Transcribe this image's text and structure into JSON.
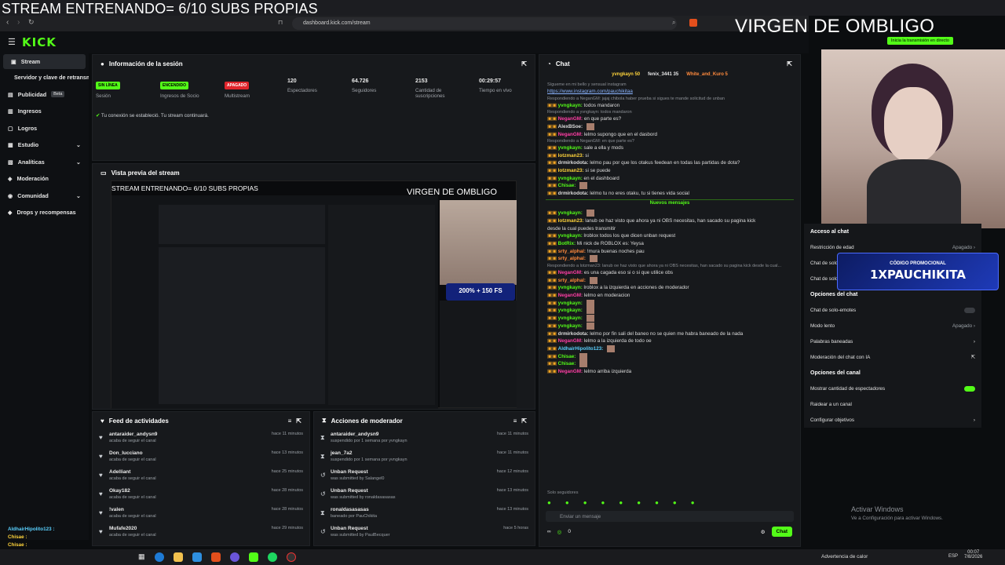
{
  "overlay": {
    "left_title": "STREAM ENTRENANDO= 6/10 SUBS PROPIAS",
    "right_title": "VIRGEN DE OMBLIGO"
  },
  "browser": {
    "url": "dashboard.kick.com/stream"
  },
  "brand": {
    "logo": "KICK",
    "accent": "#53fc18"
  },
  "header": {
    "start_stream": "Inicia la transmisión en directo"
  },
  "sidebar": {
    "items": [
      {
        "label": "Stream",
        "icon": "stream-icon"
      },
      {
        "label": "Servidor y clave de retransmisión",
        "icon": ""
      },
      {
        "label": "Publicidad",
        "icon": "ad-icon",
        "badge": "Beta"
      },
      {
        "label": "Ingresos",
        "icon": "money-icon"
      },
      {
        "label": "Logros",
        "icon": "trophy-icon"
      },
      {
        "label": "Estudio",
        "icon": "studio-icon"
      },
      {
        "label": "Analíticas",
        "icon": "analytics-icon"
      },
      {
        "label": "Moderación",
        "icon": "shield-icon"
      },
      {
        "label": "Comunidad",
        "icon": "community-icon"
      },
      {
        "label": "Drops y recompensas",
        "icon": "gift-icon"
      }
    ]
  },
  "session": {
    "title": "Información de la sesión",
    "stats": [
      {
        "badge": "SIN LÍNEA",
        "label": "Sesión"
      },
      {
        "badge": "ENCENDIDO",
        "label": "Ingresos de Socio"
      },
      {
        "badge": "APAGADO",
        "label": "Multistream"
      },
      {
        "value": "120",
        "label": "Espectadores"
      },
      {
        "value": "64.726",
        "label": "Seguidores"
      },
      {
        "value": "2153",
        "label": "Cantidad de suscripciones"
      },
      {
        "value": "00:29:57",
        "label": "Tiempo en vivo"
      }
    ],
    "status": "Tu conexión se estableció. Tu stream continuará."
  },
  "preview": {
    "title": "Vista previa del stream",
    "promo_line1": "200% + 150 FS"
  },
  "feed": {
    "title": "Feed de actividades",
    "rows": [
      {
        "name": "antaraider_andysn9",
        "sub": "acaba de seguir el canal",
        "time": "hace 11 minutos"
      },
      {
        "name": "Don_lucciano",
        "sub": "acaba de seguir el canal",
        "time": "hace 13 minutos"
      },
      {
        "name": "Adelliant",
        "sub": "acaba de seguir el canal",
        "time": "hace 25 minutos"
      },
      {
        "name": "Okay182",
        "sub": "acaba de seguir el canal",
        "time": "hace 28 minutos"
      },
      {
        "name": "!valen",
        "sub": "acaba de seguir el canal",
        "time": "hace 28 minutos"
      },
      {
        "name": "Mufafe2020",
        "sub": "acaba de seguir el canal",
        "time": "hace 29 minutos"
      }
    ]
  },
  "modactions": {
    "title": "Acciones de moderador",
    "rows": [
      {
        "name": "antaraider_andysn9",
        "sub": "suspendido por 1 semana por yvngkayn",
        "time": "hace 11 minutos"
      },
      {
        "name": "jean_7a2",
        "sub": "suspendido por 1 semana por yvngkayn",
        "time": "hace 11 minutos"
      },
      {
        "name": "Unban Request",
        "sub": "was submitted by Salangel0",
        "time": "hace 12 minutos"
      },
      {
        "name": "Unban Request",
        "sub": "was submitted by ronaldasasasas",
        "time": "hace 13 minutos"
      },
      {
        "name": "ronaldasasasas",
        "sub": "baneado por PauChikita",
        "time": "hace 13 minutos"
      },
      {
        "name": "Unban Request",
        "sub": "was submitted by PaulBecquer",
        "time": "hace 5 horas"
      }
    ]
  },
  "chat": {
    "title": "Chat",
    "pinned": [
      "yvngkayn 50",
      "fenix_3441 35",
      "White_and_Kuro 5"
    ],
    "messages": [
      {
        "user": "",
        "text": "Sígueme en mi bello y sensual instagram",
        "cls": "sys"
      },
      {
        "user": "",
        "text": "https://www.instagram.com/pauchikitaa",
        "cls": "link"
      },
      {
        "user": "",
        "text": "Respondiendo a NeganGM: jajaj chibola haber prueba si sigues te mande solicitud de unban",
        "cls": "sys"
      },
      {
        "user": "yvngkayn:",
        "text": "todos mandaron",
        "cls": "g"
      },
      {
        "user": "",
        "text": "Respondiendo a yvngkayn: todos mandaron",
        "cls": "sys"
      },
      {
        "user": "NeganGM:",
        "text": "en que parte es?",
        "cls": "p"
      },
      {
        "user": "AlexBSoe:",
        "text": "",
        "cls": "w"
      },
      {
        "user": "NeganGM:",
        "text": "lelmo supongo que en el dasbord",
        "cls": "p"
      },
      {
        "user": "",
        "text": "Respondiendo a NeganGM: en que parte es?",
        "cls": "sys"
      },
      {
        "user": "yvngkayn:",
        "text": "sale a ella y mods",
        "cls": "g"
      },
      {
        "user": "lotzman23:",
        "text": "si",
        "cls": "y"
      },
      {
        "user": "drmirkodota:",
        "text": "lelmo pau por que los otakus feedean en todas las partidas de dota?",
        "cls": "w"
      },
      {
        "user": "lotzman23:",
        "text": "si se puede",
        "cls": "y"
      },
      {
        "user": "yvngkayn:",
        "text": "en el dashboard",
        "cls": "g"
      },
      {
        "user": "Chisae:",
        "text": "",
        "cls": "g"
      },
      {
        "user": "drmirkodota:",
        "text": "lelmo tu no eres otaku, tu si tienes vida social",
        "cls": "w"
      },
      {
        "user": "",
        "text": "Nuevos mensajes",
        "cls": "divider"
      },
      {
        "user": "yvngkayn:",
        "text": "",
        "cls": "g"
      },
      {
        "user": "lotzman23:",
        "text": "lanub oe haz visto que ahora ya ni OBS necesitas, han sacado su pagina kick",
        "cls": "y"
      },
      {
        "user": "",
        "text": "desde la cual puedes transmitir",
        "cls": "cont"
      },
      {
        "user": "yvngkayn:",
        "text": "lroblox todos los que dicen unban request",
        "cls": "g"
      },
      {
        "user": "BotRix:",
        "text": "Mi nick de ROBLOX es: Yeysa",
        "cls": "g"
      },
      {
        "user": "srty_alphal:",
        "text": "!mura buenas noches pau",
        "cls": "o"
      },
      {
        "user": "srty_alphal:",
        "text": "",
        "cls": "o"
      },
      {
        "user": "",
        "text": "Respondiendo a lotzman23: lanub oe haz visto que ahora ya ni OBS necesitas, han sacado su pagina kick desde la cual...",
        "cls": "sys"
      },
      {
        "user": "NeganGM:",
        "text": "es una cagada eso si o si que utilice obs",
        "cls": "p"
      },
      {
        "user": "srty_alphal:",
        "text": "",
        "cls": "o"
      },
      {
        "user": "yvngkayn:",
        "text": "lroblox a la izquierda en acciones de moderador",
        "cls": "g"
      },
      {
        "user": "NeganGM:",
        "text": "lelmo en moderacion",
        "cls": "p"
      },
      {
        "user": "yvngkayn:",
        "text": "",
        "cls": "g"
      },
      {
        "user": "yvngkayn:",
        "text": "",
        "cls": "g"
      },
      {
        "user": "yvngkayn:",
        "text": "",
        "cls": "g"
      },
      {
        "user": "yvngkayn:",
        "text": "",
        "cls": "g"
      },
      {
        "user": "drmirkodota:",
        "text": "lelmo por fin sali del baneo no se quien me habra baneado de la nada",
        "cls": "w"
      },
      {
        "user": "NeganGM:",
        "text": "lelmo a la izquierda de todo oe",
        "cls": "p"
      },
      {
        "user": "AldhairHipolito123:",
        "text": "",
        "cls": "c"
      },
      {
        "user": "Chisae:",
        "text": "",
        "cls": "g"
      },
      {
        "user": "Chisae:",
        "text": "",
        "cls": "g"
      },
      {
        "user": "NeganGM:",
        "text": "lelmo arriba izquierda",
        "cls": "p"
      }
    ],
    "followers_only": "Solo seguidores",
    "input_placeholder": "Enviar un mensaje",
    "send": "Chat",
    "count": "0"
  },
  "settings": {
    "section_chat": "Acceso al chat",
    "rows_chat": [
      {
        "label": "Restricción de edad",
        "value": "Apagado"
      },
      {
        "label": "Chat de solo...",
        "value": ""
      },
      {
        "label": "Chat de solo...",
        "value": ""
      }
    ],
    "section_opts": "Opciones del chat",
    "rows_opts": [
      {
        "label": "Chat de solo-emotes",
        "value": ""
      },
      {
        "label": "Modo lento",
        "value": "Apagado"
      },
      {
        "label": "Palabras baneadas",
        "value": ""
      },
      {
        "label": "Moderación del chat con IA",
        "value": ""
      }
    ],
    "section_channel": "Opciones del canal",
    "rows_channel": [
      {
        "label": "Mostrar cantidad de espectadores",
        "value": ""
      },
      {
        "label": "Raidear a un canal",
        "value": ""
      },
      {
        "label": "Configurar objetivos",
        "value": ""
      }
    ]
  },
  "promo": {
    "label": "CÓDIGO PROMOCIONAL",
    "code": "1XPAUCHIKITA"
  },
  "windows": {
    "line1": "Activar Windows",
    "line2": "Ve a Configuración para activar Windows."
  },
  "overlay_chat": [
    {
      "user": "AldhairHipolito123 :",
      "text": ""
    },
    {
      "user": "Chisae :",
      "text": ""
    },
    {
      "user": "Chisae :",
      "text": ""
    },
    {
      "user": "NeganGM :",
      "text": "lelmo arriba izquierda"
    }
  ],
  "taskbar": {
    "weather": "Advertencia de calor",
    "lang": "ESP",
    "time": "00:07",
    "date": "7/8/2026"
  }
}
